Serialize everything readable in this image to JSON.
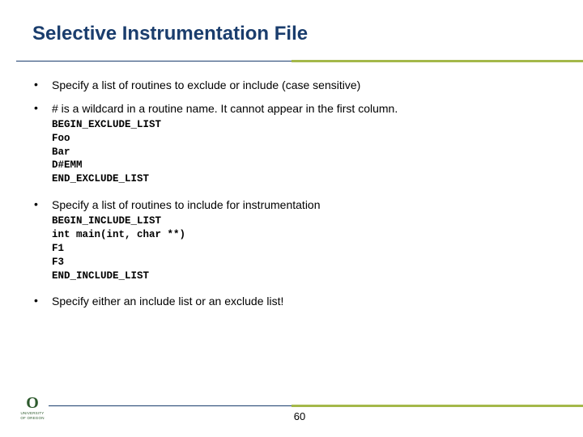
{
  "title": "Selective Instrumentation File",
  "bullets": {
    "b1": "Specify a list of routines to exclude or include (case sensitive)",
    "b2": "# is a wildcard in a routine name. It cannot appear in the first column.",
    "b3": "Specify a list of routines to include for instrumentation",
    "b4": "Specify either an include list or an exclude list!"
  },
  "code1": "BEGIN_EXCLUDE_LIST\nFoo\nBar\nD#EMM\nEND_EXCLUDE_LIST",
  "code2": "BEGIN_INCLUDE_LIST\nint main(int, char **)\nF1\nF3\nEND_INCLUDE_LIST",
  "logo": {
    "mark": "O",
    "line1": "UNIVERSITY",
    "line2": "OF OREGON"
  },
  "page": "60"
}
